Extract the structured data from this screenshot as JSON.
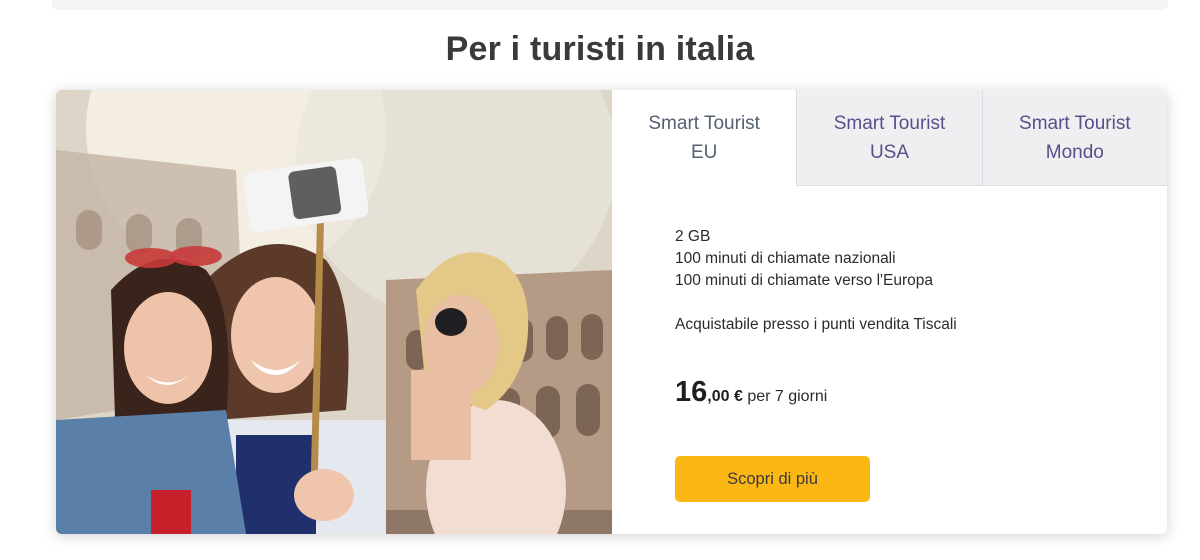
{
  "section": {
    "title": "Per i turisti in italia"
  },
  "tabs": [
    {
      "label": "Smart Tourist\nEU",
      "active": true
    },
    {
      "label": "Smart Tourist\nUSA",
      "active": false
    },
    {
      "label": "Smart Tourist\nMondo",
      "active": false
    }
  ],
  "offer": {
    "features": [
      "2 GB",
      "100 minuti di chiamate nazionali",
      "100 minuti di chiamate verso l'Europa"
    ],
    "availability": "Acquistabile presso i punti vendita Tiscali",
    "price_integer": "16",
    "price_decimal": ",00 €",
    "price_period": "per 7 giorni",
    "cta_label": "Scopri di più"
  },
  "colors": {
    "tab_text": "#5a4e8a",
    "tab_background": "#efeff2",
    "cta_background": "#fbb714"
  },
  "image": {
    "subject": "three-women-selfie-colosseum-photo"
  }
}
